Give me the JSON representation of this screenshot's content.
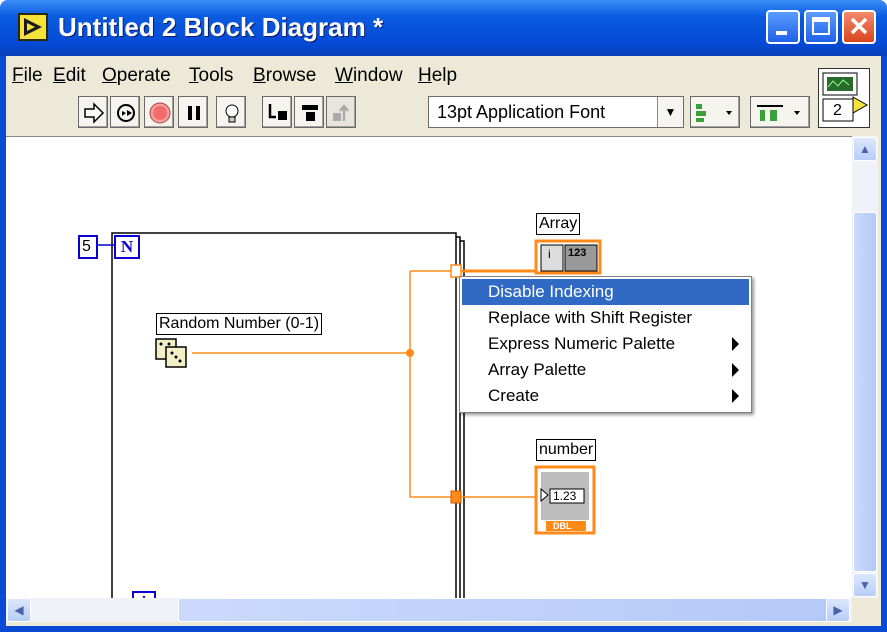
{
  "window": {
    "title": "Untitled 2 Block Diagram *"
  },
  "menu": [
    "File",
    "Edit",
    "Operate",
    "Tools",
    "Browse",
    "Window",
    "Help"
  ],
  "menu_mnemonic": [
    "F",
    "E",
    "O",
    "T",
    "B",
    "W",
    "H"
  ],
  "menu_rest": [
    "ile",
    "dit",
    "perate",
    "ools",
    "rowse",
    "indow",
    "elp"
  ],
  "toolbar": {
    "font": "13pt Application Font",
    "buttons": [
      "run-arrow-icon",
      "run-continuously-icon",
      "abort-icon",
      "pause-icon",
      "highlight-execution-icon",
      "step-into-icon",
      "step-over-icon",
      "step-out-icon"
    ],
    "align_icons": [
      "align-objects-icon",
      "distribute-objects-icon"
    ]
  },
  "context_help": {
    "label": "2"
  },
  "diagram": {
    "count_constant": "5",
    "count_terminal": "N",
    "iteration_terminal": "i",
    "random_label": "Random Number (0-1)",
    "array_label": "Array",
    "array_index": "i",
    "array_type": "123",
    "number_label": "number",
    "number_value": "1.23",
    "number_type": "DBL",
    "colors": {
      "wire": "#ff8a1a",
      "terminal": "#0a00d6",
      "loop_border": "#000000"
    }
  },
  "context_menu": {
    "items": [
      {
        "label": "Disable Indexing",
        "highlighted": true,
        "submenu": false
      },
      {
        "label": "Replace with Shift Register",
        "highlighted": false,
        "submenu": false
      },
      {
        "label": "Express Numeric Palette",
        "highlighted": false,
        "submenu": true
      },
      {
        "label": "Array Palette",
        "highlighted": false,
        "submenu": true
      },
      {
        "label": "Create",
        "highlighted": false,
        "submenu": true
      }
    ]
  }
}
